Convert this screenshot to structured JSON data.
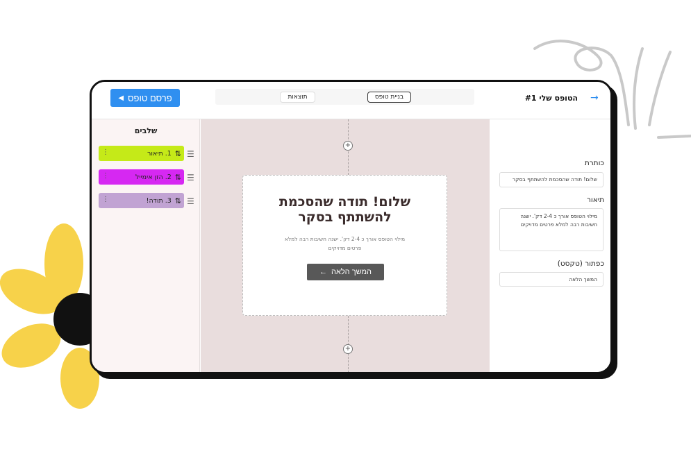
{
  "header": {
    "publish_label": "פרסם טופס",
    "tabs": [
      {
        "label": "תוצאות"
      },
      {
        "label": "בניית טופס"
      }
    ],
    "form_title": "הטופס שלי #1",
    "back_icon": "arrow-right-icon"
  },
  "steps": {
    "title": "שלבים",
    "items": [
      {
        "label": "1. תיאור",
        "color": "#c5ea18"
      },
      {
        "label": "2. הזן אימייל",
        "color": "#d628f2"
      },
      {
        "label": "3. תודה!",
        "color": "#c1a3d3"
      }
    ]
  },
  "preview": {
    "title": "שלום! תודה שהסכמת להשתתף בסקר",
    "description": "מילוי הטופס אורך כ 2-4 דק'. ישנה חשיבות רבה למלא פרטים מדויקים",
    "button_label": "המשך הלאה",
    "button_arrow": "←"
  },
  "properties": {
    "title_label": "כותרת",
    "title_value": "שלום! תודה שהסכמת להשתתף בסקר",
    "description_label": "תיאור",
    "description_value": "מילוי הטופס אורך כ 2-4 דק'. ישנה חשיבות רבה למלא פרטים מדויקים",
    "button_label": "כפתור (טקסט)",
    "button_value": "המשך הלאה"
  },
  "colors": {
    "accent": "#2f8ff0",
    "canvas": "#e9dddd",
    "sidebar": "#fbf4f4",
    "flower": "#f7d24a"
  }
}
